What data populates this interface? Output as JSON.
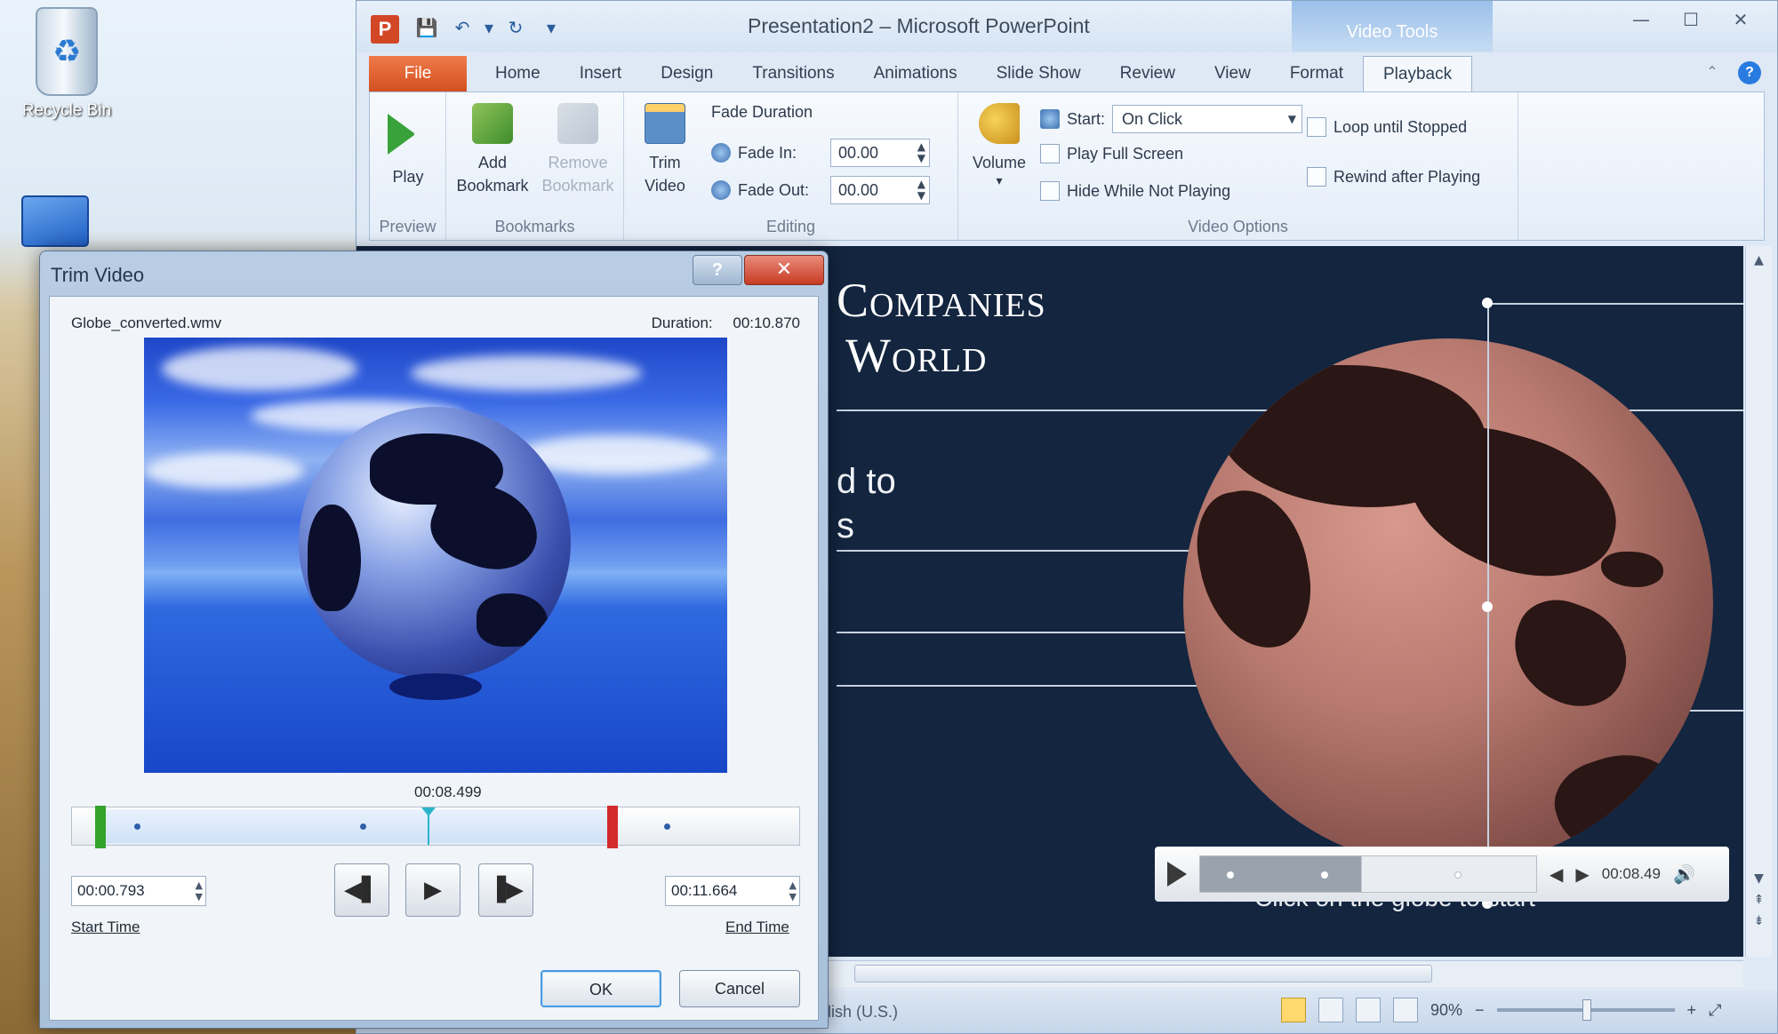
{
  "desktop": {
    "recycle_label": "Recycle Bin"
  },
  "powerpoint": {
    "app_logo": "P",
    "qat": {
      "save": "💾",
      "undo": "↶",
      "undo_dropdown": "▾",
      "redo": "↻",
      "customize": "▾"
    },
    "title": "Presentation2 – Microsoft PowerPoint",
    "contextual_tab": "Video Tools",
    "window_buttons": {
      "minimize": "—",
      "maximize": "☐",
      "close": "✕"
    },
    "tabs": [
      "File",
      "Home",
      "Insert",
      "Design",
      "Transitions",
      "Animations",
      "Slide Show",
      "Review",
      "View",
      "Format",
      "Playback"
    ],
    "active_tab": "Playback",
    "help_icons": {
      "minimize_ribbon": "⌃",
      "help": "?"
    },
    "ribbon": {
      "preview": {
        "play_label": "Play",
        "group_label": "Preview"
      },
      "bookmarks": {
        "add_label_1": "Add",
        "add_label_2": "Bookmark",
        "remove_label_1": "Remove",
        "remove_label_2": "Bookmark",
        "group_label": "Bookmarks"
      },
      "editing": {
        "trim_label_1": "Trim",
        "trim_label_2": "Video",
        "fade_duration_label": "Fade Duration",
        "fade_in_label": "Fade In:",
        "fade_in_value": "00.00",
        "fade_out_label": "Fade Out:",
        "fade_out_value": "00.00",
        "group_label": "Editing"
      },
      "video_options": {
        "volume_label": "Volume",
        "volume_dropdown": "▾",
        "start_label": "Start:",
        "start_value": "On Click",
        "play_full_screen": "Play Full Screen",
        "hide_while_not_playing": "Hide While Not Playing",
        "loop_until_stopped": "Loop until Stopped",
        "rewind_after_playing": "Rewind after Playing",
        "group_label": "Video Options"
      }
    },
    "slide": {
      "title_line1": "Companies",
      "title_line2": "World",
      "body_line1": "d to",
      "body_line2": "s",
      "caption": "Click on the globe to start"
    },
    "media_bar": {
      "time": "00:08.49",
      "prev": "◀",
      "next": "▶",
      "volume": "🔊"
    },
    "vscroll": {
      "up": "▲",
      "down": "▼",
      "prev_slide": "⇞",
      "next_slide": "⇟"
    },
    "status": {
      "language": "lish (U.S.)",
      "zoom": "90%",
      "zoom_out": "−",
      "zoom_in": "+",
      "fit": "⤢"
    }
  },
  "trim_dialog": {
    "title": "Trim Video",
    "help_button": "?",
    "close_button": "✕",
    "file_name": "Globe_converted.wmv",
    "duration_label": "Duration:",
    "duration_value": "00:10.870",
    "current_time": "00:08.499",
    "start_time_value": "00:00.793",
    "end_time_value": "00:11.664",
    "start_time_label": "Start Time",
    "end_time_label": "End Time",
    "prev_frame": "◀▌",
    "play": "▶",
    "next_frame": "▐▶",
    "ok_label": "OK",
    "cancel_label": "Cancel"
  }
}
